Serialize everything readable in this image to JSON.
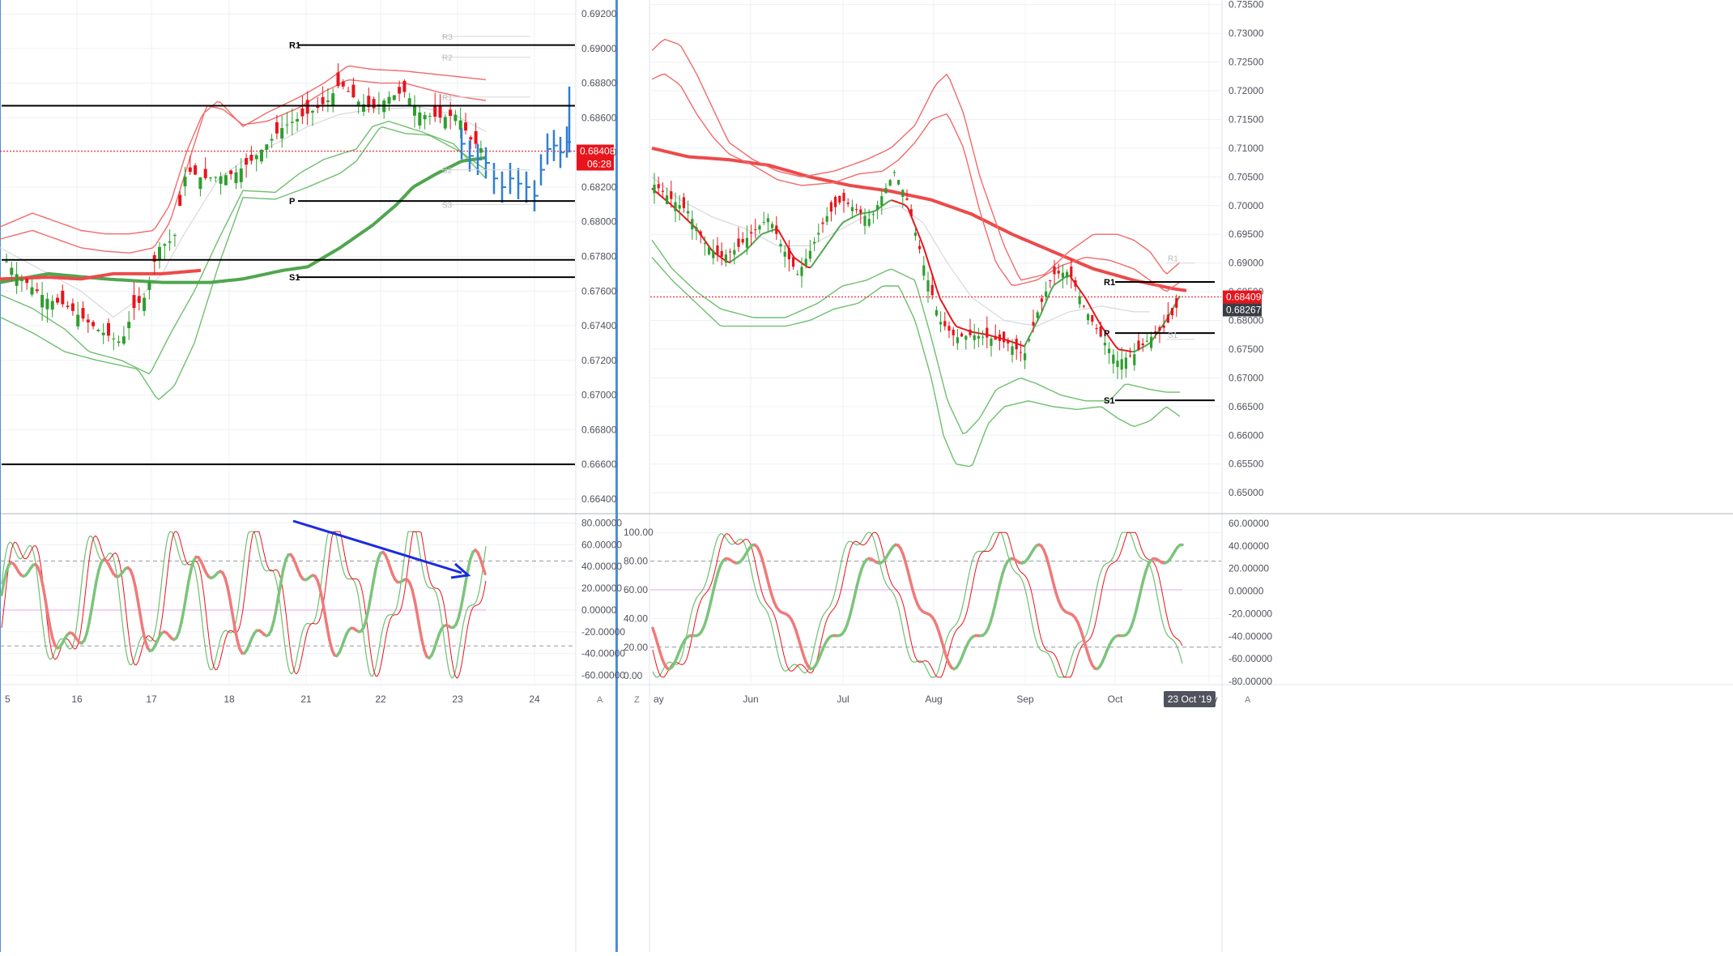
{
  "colors": {
    "bull": "#2e9e2e",
    "bear": "#e8141c",
    "bb_red": "#f26a6a",
    "bb_green": "#6fbf6f",
    "ma_red": "#ec4a4a",
    "ma_green": "#4fa64f",
    "ma_grey": "#d6d8de",
    "bar_blue": "#2f7fd4",
    "arrow_blue": "#1a2be0",
    "axis_text": "#50535e",
    "grid": "#eef0f3",
    "divider": "#4a90d9",
    "level_line": "#000000",
    "ghost_text": "#b7b9bf"
  },
  "panel_left": {
    "price_axis": {
      "ticks": [
        "0.69200",
        "0.69000",
        "0.68800",
        "0.68600",
        "0.68400",
        "0.68200",
        "0.68000",
        "0.67800",
        "0.67600",
        "0.67400",
        "0.67200",
        "0.67000",
        "0.66800",
        "0.66600",
        "0.66400"
      ],
      "min": 0.6632,
      "max": 0.6928
    },
    "last_price": "0.68408",
    "countdown": "06:28",
    "date_axis": [
      "5",
      "16",
      "17",
      "18",
      "21",
      "22",
      "23",
      "24"
    ],
    "axis_corner": "A",
    "levels": [
      {
        "label": "R1",
        "value": 0.6902
      },
      {
        "label": "",
        "value": 0.6867
      },
      {
        "label": "P",
        "value": 0.6812
      },
      {
        "label": "",
        "value": 0.6778
      },
      {
        "label": "S1",
        "value": 0.6768
      },
      {
        "label": "",
        "value": 0.666
      }
    ],
    "ghost_levels": [
      {
        "label": "R3",
        "value": 0.6907
      },
      {
        "label": "R2",
        "value": 0.6895
      },
      {
        "label": "R1",
        "value": 0.6872
      },
      {
        "label": "S2",
        "value": 0.683
      },
      {
        "label": "S3",
        "value": 0.681
      }
    ],
    "osc_axis": {
      "ticks": [
        "80.00000",
        "60.00000",
        "40.00000",
        "20.00000",
        "0.00000",
        "-20.00000",
        "-40.00000",
        "-60.00000"
      ],
      "min": -67,
      "max": 87,
      "upper_dashed": 45,
      "zero": 0,
      "lower_dashed": -33
    }
  },
  "panel_right": {
    "price_axis": {
      "ticks": [
        "0.73500",
        "0.73000",
        "0.72500",
        "0.72000",
        "0.71500",
        "0.71000",
        "0.70500",
        "0.70000",
        "0.69500",
        "0.69000",
        "0.68500",
        "0.68000",
        "0.67500",
        "0.67000",
        "0.66500",
        "0.66000",
        "0.65500",
        "0.65000"
      ],
      "min": 0.6465,
      "max": 0.7358
    },
    "last_price": "0.68409",
    "second_price": "0.68267",
    "date_axis": [
      "ay",
      "Jun",
      "Jul",
      "Aug",
      "Sep",
      "Oct",
      "Nov"
    ],
    "date_highlight": "23 Oct '19",
    "axis_corner_left": "Z",
    "axis_corner": "A",
    "levels": [
      {
        "label": "R1",
        "value": 0.6867
      },
      {
        "label": "P",
        "value": 0.6778
      },
      {
        "label": "S1",
        "value": 0.6661
      }
    ],
    "ghost_levels": [
      {
        "label": "R1",
        "value": 0.69
      },
      {
        "label": "S1",
        "value": 0.6767
      }
    ],
    "osc_left_axis": {
      "ticks": [
        "100.00",
        "80.00",
        "60.00",
        "40.00",
        "20.00",
        "0.00"
      ],
      "min": -5,
      "max": 112,
      "upper_dashed": 80,
      "mid": 60,
      "lower_dashed": 20
    },
    "osc_right_axis": {
      "ticks": [
        "60.00000",
        "40.00000",
        "20.00000",
        "0.00000",
        "-20.00000",
        "-40.00000",
        "-60.00000",
        "-80.00000"
      ]
    }
  }
}
